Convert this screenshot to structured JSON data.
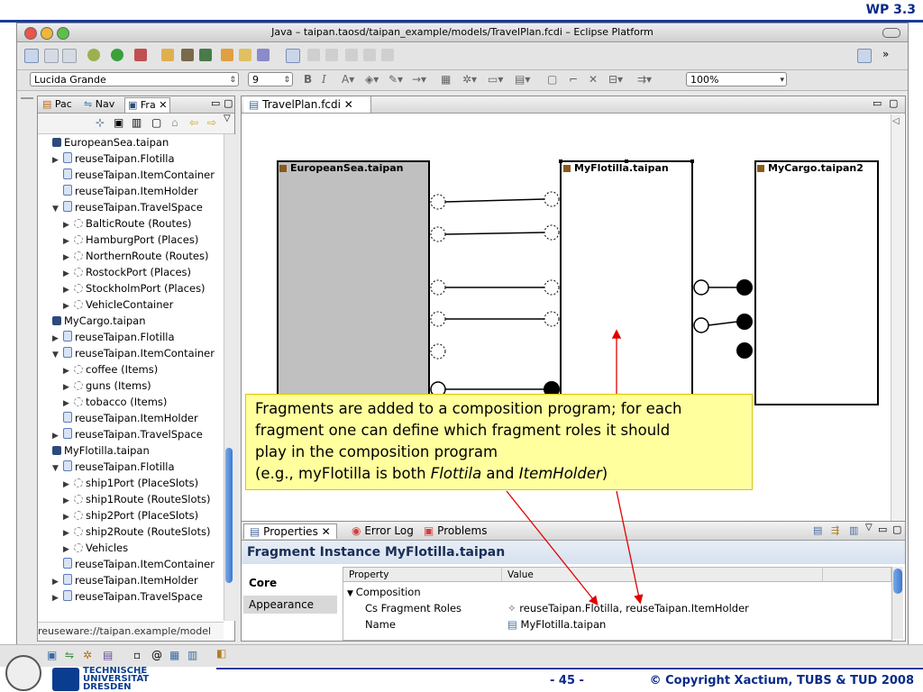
{
  "slide": {
    "label": "WP 3.3",
    "page_number": "- 45 -",
    "copyright": "© Copyright Xactium, TUBS & TUD 2008",
    "logo_text": [
      "TECHNISCHE",
      "UNIVERSITÄT",
      "DRESDEN"
    ]
  },
  "window": {
    "title": "Java – taipan.taosd/taipan_example/models/TravelPlan.fcdi – Eclipse Platform"
  },
  "toolbar2": {
    "font": "Lucida Grande",
    "size": "9",
    "zoom": "100%",
    "bold": "B",
    "italic": "I"
  },
  "left_view": {
    "tabs": [
      "Pac",
      "Nav",
      "Fra"
    ],
    "tree": [
      {
        "indent": 0,
        "twisty": "",
        "icon": "tp",
        "label": "EuropeanSea.taipan"
      },
      {
        "indent": 1,
        "twisty": "▶",
        "icon": "pkg",
        "label": "reuseTaipan.Flotilla"
      },
      {
        "indent": 1,
        "twisty": "",
        "icon": "pkg",
        "label": "reuseTaipan.ItemContainer"
      },
      {
        "indent": 1,
        "twisty": "",
        "icon": "pkg",
        "label": "reuseTaipan.ItemHolder"
      },
      {
        "indent": 1,
        "twisty": "▼",
        "icon": "pkg",
        "label": "reuseTaipan.TravelSpace"
      },
      {
        "indent": 2,
        "twisty": "▶",
        "icon": "dot",
        "label": "BalticRoute (Routes)"
      },
      {
        "indent": 2,
        "twisty": "▶",
        "icon": "dot",
        "label": "HamburgPort (Places)"
      },
      {
        "indent": 2,
        "twisty": "▶",
        "icon": "dot",
        "label": "NorthernRoute (Routes)"
      },
      {
        "indent": 2,
        "twisty": "▶",
        "icon": "dot",
        "label": "RostockPort (Places)"
      },
      {
        "indent": 2,
        "twisty": "▶",
        "icon": "dot",
        "label": "StockholmPort (Places)"
      },
      {
        "indent": 2,
        "twisty": "▶",
        "icon": "dot",
        "label": "VehicleContainer"
      },
      {
        "indent": 0,
        "twisty": "",
        "icon": "tp",
        "label": "MyCargo.taipan"
      },
      {
        "indent": 1,
        "twisty": "▶",
        "icon": "pkg",
        "label": "reuseTaipan.Flotilla"
      },
      {
        "indent": 1,
        "twisty": "▼",
        "icon": "pkg",
        "label": "reuseTaipan.ItemContainer"
      },
      {
        "indent": 2,
        "twisty": "▶",
        "icon": "dot",
        "label": "coffee (Items)"
      },
      {
        "indent": 2,
        "twisty": "▶",
        "icon": "dot",
        "label": "guns (Items)"
      },
      {
        "indent": 2,
        "twisty": "▶",
        "icon": "dot",
        "label": "tobacco (Items)"
      },
      {
        "indent": 1,
        "twisty": "",
        "icon": "pkg",
        "label": "reuseTaipan.ItemHolder"
      },
      {
        "indent": 1,
        "twisty": "▶",
        "icon": "pkg",
        "label": "reuseTaipan.TravelSpace"
      },
      {
        "indent": 0,
        "twisty": "",
        "icon": "tp",
        "label": "MyFlotilla.taipan"
      },
      {
        "indent": 1,
        "twisty": "▼",
        "icon": "pkg",
        "label": "reuseTaipan.Flotilla"
      },
      {
        "indent": 2,
        "twisty": "▶",
        "icon": "dot",
        "label": "ship1Port (PlaceSlots)"
      },
      {
        "indent": 2,
        "twisty": "▶",
        "icon": "dot",
        "label": "ship1Route (RouteSlots)"
      },
      {
        "indent": 2,
        "twisty": "▶",
        "icon": "dot",
        "label": "ship2Port (PlaceSlots)"
      },
      {
        "indent": 2,
        "twisty": "▶",
        "icon": "dot",
        "label": "ship2Route (RouteSlots)"
      },
      {
        "indent": 2,
        "twisty": "▶",
        "icon": "dot",
        "label": "Vehicles"
      },
      {
        "indent": 1,
        "twisty": "",
        "icon": "pkg",
        "label": "reuseTaipan.ItemContainer"
      },
      {
        "indent": 1,
        "twisty": "▶",
        "icon": "pkg",
        "label": "reuseTaipan.ItemHolder"
      },
      {
        "indent": 1,
        "twisty": "▶",
        "icon": "pkg",
        "label": "reuseTaipan.TravelSpace"
      }
    ],
    "status": "reuseware://taipan.example/model"
  },
  "editor": {
    "tab": "TravelPlan.fcdi",
    "fragments": [
      {
        "label": "EuropeanSea.taipan"
      },
      {
        "label": "MyFlotilla.taipan"
      },
      {
        "label": "MyCargo.taipan2"
      }
    ]
  },
  "callout": {
    "line1": "Fragments are added to a composition program; for each",
    "line2": "fragment one can define which fragment roles it should",
    "line3": "play in the composition program",
    "line4_prefix": "(e.g., myFlotilla is both ",
    "line4_em1": "Flottila",
    "line4_mid": " and ",
    "line4_em2": "ItemHolder",
    "line4_suffix": ")"
  },
  "properties": {
    "tabs": [
      "Properties",
      "Error Log",
      "Problems"
    ],
    "header": "Fragment Instance MyFlotilla.taipan",
    "sections": [
      "Core",
      "Appearance"
    ],
    "columns": [
      "Property",
      "Value"
    ],
    "rows": [
      {
        "twisty": "▼",
        "property": "Composition",
        "value": ""
      },
      {
        "twisty": "",
        "property": "Cs Fragment Roles",
        "value": "reuseTaipan.Flotilla, reuseTaipan.ItemHolder"
      },
      {
        "twisty": "",
        "property": "Name",
        "value": "MyFlotilla.taipan"
      }
    ]
  },
  "colors": {
    "slide_blue": "#0a2a8a",
    "callout_bg": "#ffff9e",
    "arrow_red": "#e00000"
  }
}
